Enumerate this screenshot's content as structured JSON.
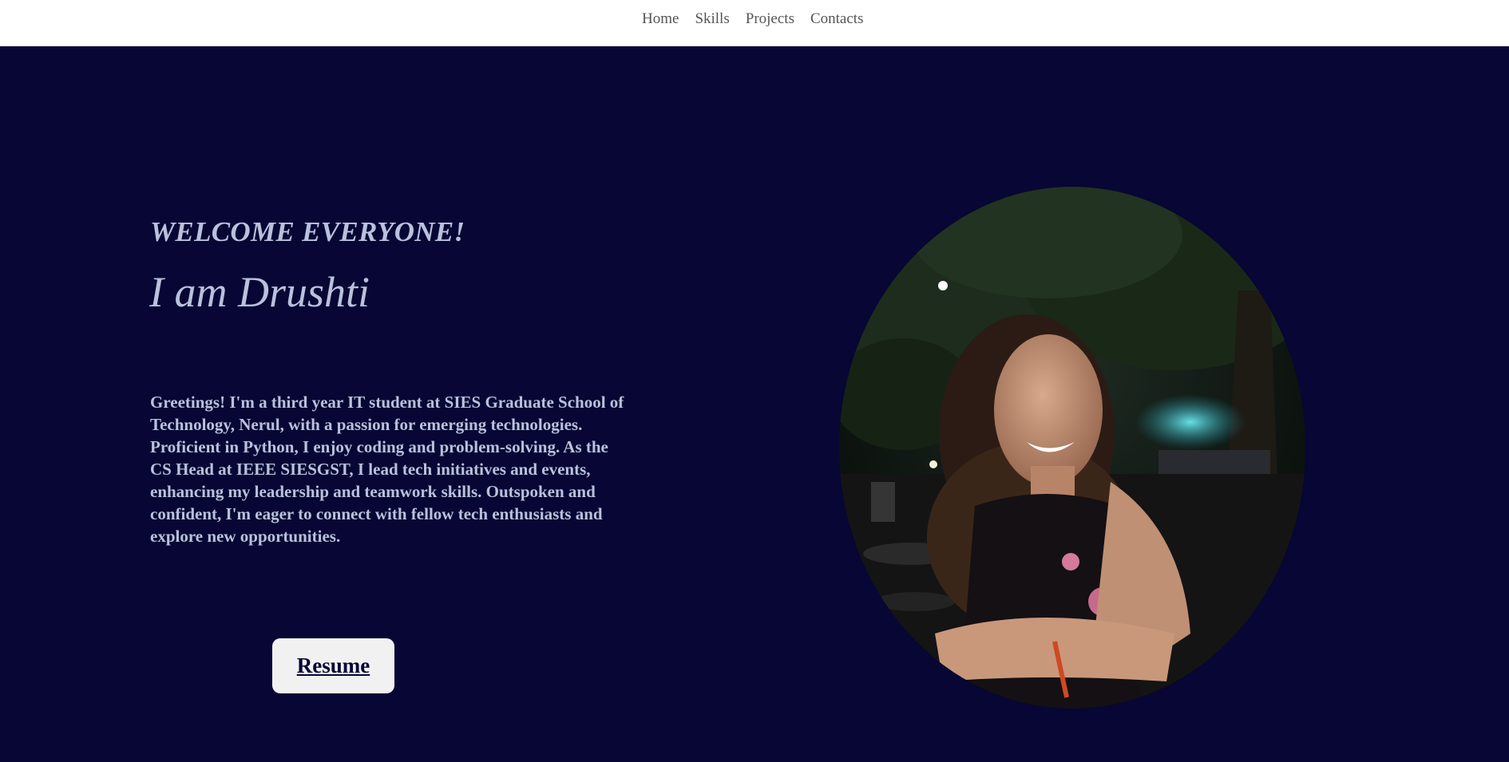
{
  "nav": {
    "items": [
      {
        "label": "Home"
      },
      {
        "label": "Skills"
      },
      {
        "label": "Projects"
      },
      {
        "label": "Contacts"
      }
    ]
  },
  "hero": {
    "welcome": "WELCOME EVERYONE!",
    "name": "I am Drushti",
    "bio": "Greetings! I'm a third year IT student at SIES Graduate School of Technology, Nerul, with a passion for emerging technologies. Proficient in Python, I enjoy coding and problem-solving. As the CS Head at IEEE SIESGST, I lead tech initiatives and events, enhancing my leadership and teamwork skills. Outspoken and confident, I'm eager to connect with fellow tech enthusiasts and explore new opportunities.",
    "resume_label": "Resume"
  },
  "colors": {
    "hero_background": "#070634",
    "text": "#b9c1dc",
    "button_background": "#f1f1f1",
    "nav_background": "#ffffff"
  }
}
